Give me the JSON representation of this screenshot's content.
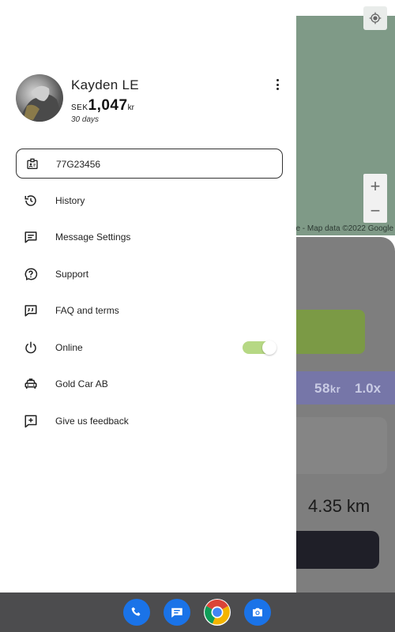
{
  "background": {
    "map_attribution": "le - Map data ©2022 Google",
    "zoom_in": "+",
    "zoom_out": "−",
    "fare_amount": "58",
    "fare_unit": "kr",
    "multiplier": "1.0x",
    "distance": "4.35 km",
    "colors": {
      "map": "#7f9a87",
      "sheet": "#7e7e7e",
      "green_button": "#7b9a45",
      "purple_band": "#7676a8",
      "dark_button": "#1f1f28"
    }
  },
  "drawer": {
    "profile": {
      "name": "Kayden LE",
      "currency": "SEK",
      "amount": "1,047",
      "amount_unit": "kr",
      "period": "30 days",
      "avatar_icon": "avatar"
    },
    "menu_icon": "more-vert-icon",
    "vehicle_id": "77G23456",
    "items": [
      {
        "label": "History",
        "icon": "history-icon"
      },
      {
        "label": "Message Settings",
        "icon": "message-icon"
      },
      {
        "label": "Support",
        "icon": "help-icon"
      },
      {
        "label": "FAQ and terms",
        "icon": "faq-icon"
      },
      {
        "label": "Online",
        "icon": "power-icon",
        "toggle_on": true
      },
      {
        "label": "Gold Car AB",
        "icon": "car-icon"
      },
      {
        "label": "Give us feedback",
        "icon": "feedback-icon"
      }
    ],
    "toggle_color": "#b6d884"
  },
  "dock": {
    "apps": [
      {
        "icon": "phone-icon",
        "color": "#1a73e8"
      },
      {
        "icon": "messages-icon",
        "color": "#1a73e8"
      },
      {
        "icon": "chrome-icon",
        "color": "#db4437"
      },
      {
        "icon": "camera-icon",
        "color": "#1a73e8"
      }
    ]
  }
}
